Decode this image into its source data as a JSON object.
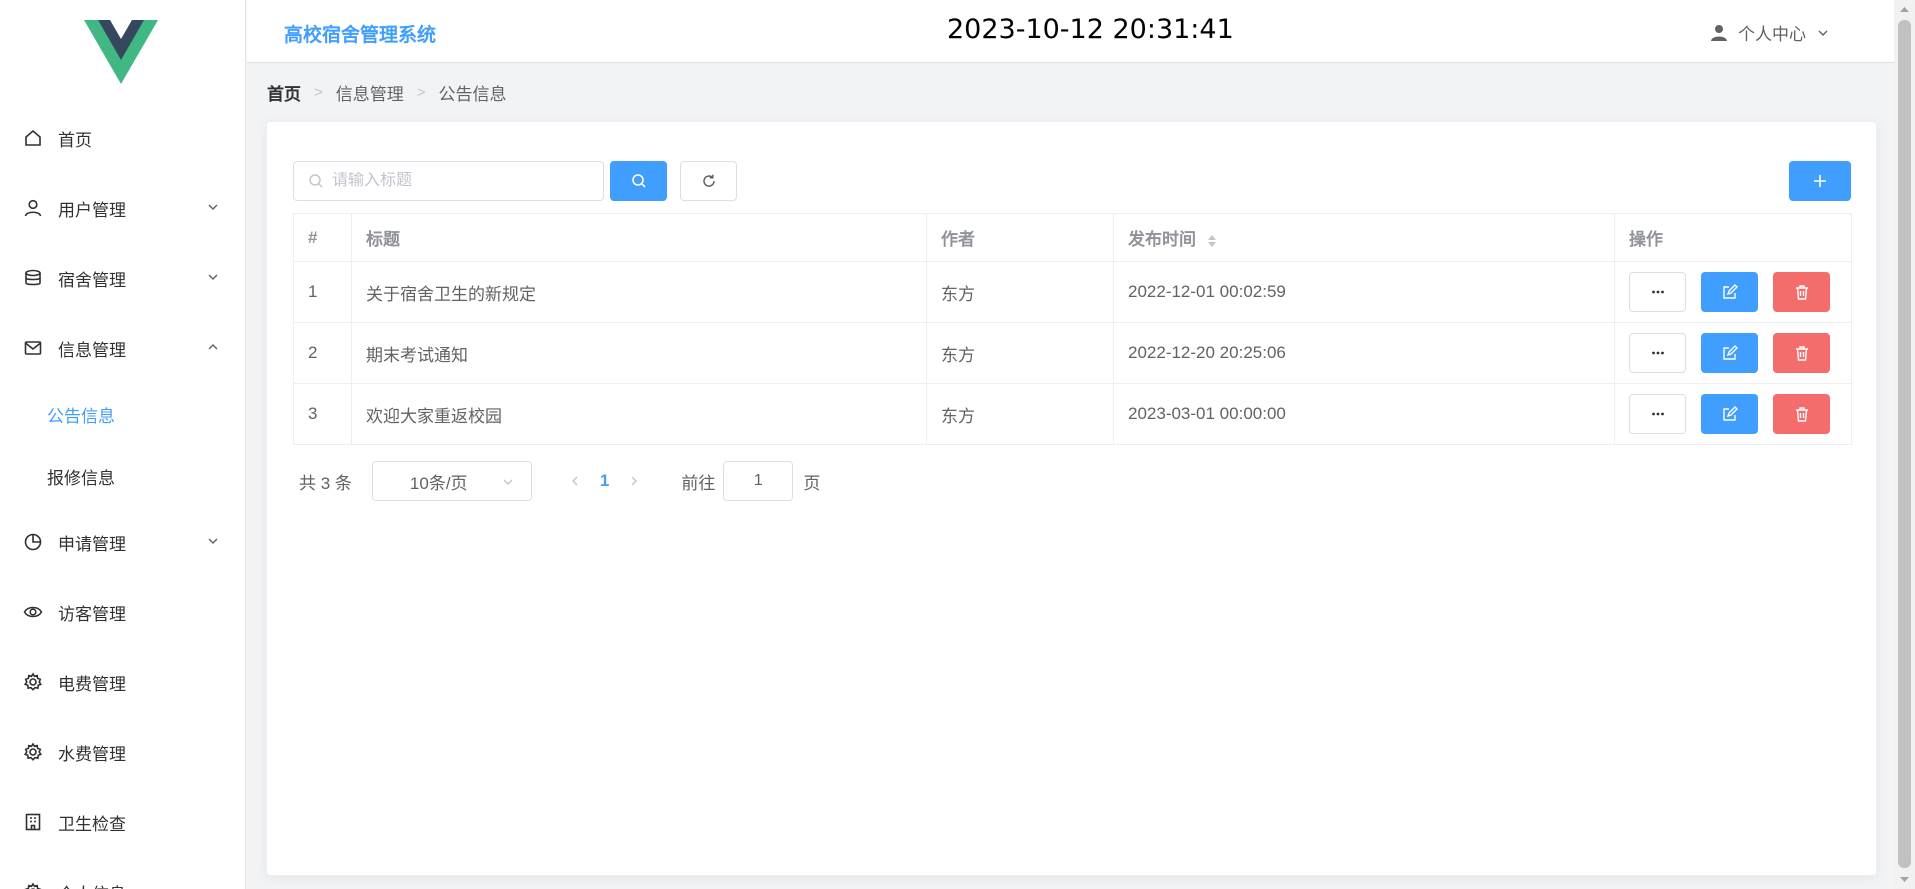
{
  "app": {
    "title": "高校宿舍管理系统",
    "clock": "2023-10-12 20:31:41",
    "user_menu": "个人中心"
  },
  "colors": {
    "primary": "#409eff",
    "danger": "#f56c6c",
    "logo_green": "#41b883",
    "logo_dark": "#35495e"
  },
  "sidebar": {
    "items": [
      {
        "label": "首页",
        "icon": "home-icon"
      },
      {
        "label": "用户管理",
        "icon": "user-icon",
        "expandable": true
      },
      {
        "label": "宿舍管理",
        "icon": "database-icon",
        "expandable": true
      },
      {
        "label": "信息管理",
        "icon": "message-icon",
        "expanded": true,
        "children": [
          {
            "label": "公告信息",
            "active": true
          },
          {
            "label": "报修信息"
          }
        ]
      },
      {
        "label": "申请管理",
        "icon": "pie-chart-icon",
        "expandable": true
      },
      {
        "label": "访客管理",
        "icon": "eye-icon"
      },
      {
        "label": "电费管理",
        "icon": "gear-icon"
      },
      {
        "label": "水费管理",
        "icon": "gear-icon"
      },
      {
        "label": "卫生检查",
        "icon": "building-icon"
      },
      {
        "label": "个人信息",
        "icon": "gear-icon"
      }
    ]
  },
  "breadcrumb": [
    "首页",
    "信息管理",
    "公告信息"
  ],
  "search": {
    "placeholder": "请输入标题",
    "value": ""
  },
  "table": {
    "columns": [
      "#",
      "标题",
      "作者",
      "发布时间",
      "操作"
    ],
    "rows": [
      {
        "index": "1",
        "title": "关于宿舍卫生的新规定",
        "author": "东方",
        "time": "2022-12-01 00:02:59"
      },
      {
        "index": "2",
        "title": "期末考试通知",
        "author": "东方",
        "time": "2022-12-20 20:25:06"
      },
      {
        "index": "3",
        "title": "欢迎大家重返校园",
        "author": "东方",
        "time": "2023-03-01 00:00:00"
      }
    ]
  },
  "pagination": {
    "total": "共 3 条",
    "page_size": "10条/页",
    "current": "1",
    "goto_label": "前往",
    "goto_value": "1",
    "unit": "页"
  }
}
